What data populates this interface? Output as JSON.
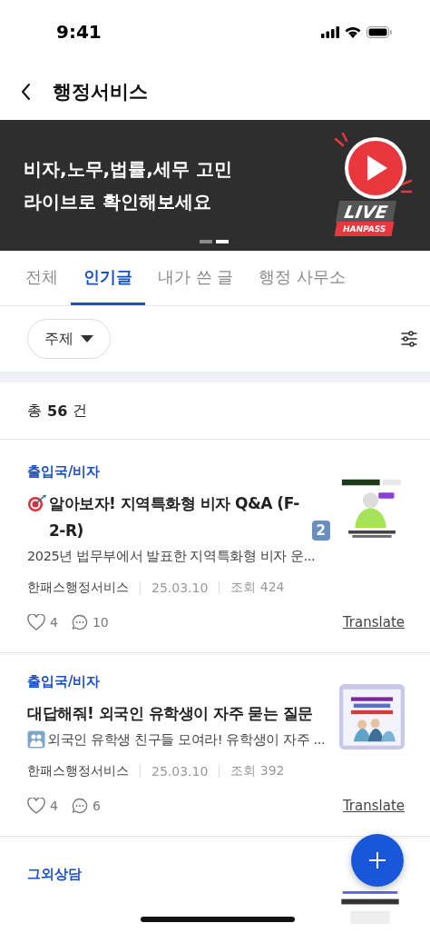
{
  "status_bar": {
    "time": "9:41"
  },
  "header": {
    "title": "행정서비스"
  },
  "banner": {
    "lines": [
      "비자,노무,법률,세무 고민",
      "라이브로 확인해보세요"
    ],
    "badge_live": "LIVE",
    "badge_brand": "HANPASS",
    "dots": [
      {
        "selected": false
      },
      {
        "selected": true
      }
    ]
  },
  "tabs": [
    {
      "label": "전체",
      "selected": false
    },
    {
      "label": "인기글",
      "selected": true
    },
    {
      "label": "내가 쓴 글",
      "selected": false
    },
    {
      "label": "행정 사무소",
      "selected": false
    }
  ],
  "filter": {
    "label": "주제"
  },
  "count": {
    "prefix": "총",
    "number": "56",
    "suffix": "건"
  },
  "posts": [
    {
      "category": "출입국/비자",
      "lead_icon": {
        "kind": "target"
      },
      "title": "알아보자! 지역특화형 비자 Q&A (F-2-R)",
      "keycap": "2",
      "preview": "2025년 법무부에서 발표한 지역특화형 비자 운...",
      "author": "한패스행정서비스",
      "date": "25.03.10",
      "views": "조회 424",
      "likes": "4",
      "comments": "10",
      "translate": "Translate"
    },
    {
      "category": "출입국/비자",
      "title": "대답해줘! 외국인 유학생이 자주 묻는 질문",
      "preview_icon": {
        "kind": "people"
      },
      "preview": "외국인 유학생 친구들 모여라! 유학생이 자주 ...",
      "author": "한패스행정서비스",
      "date": "25.03.10",
      "views": "조회 392",
      "likes": "4",
      "comments": "6",
      "translate": "Translate"
    },
    {
      "category": "그외상담"
    }
  ]
}
